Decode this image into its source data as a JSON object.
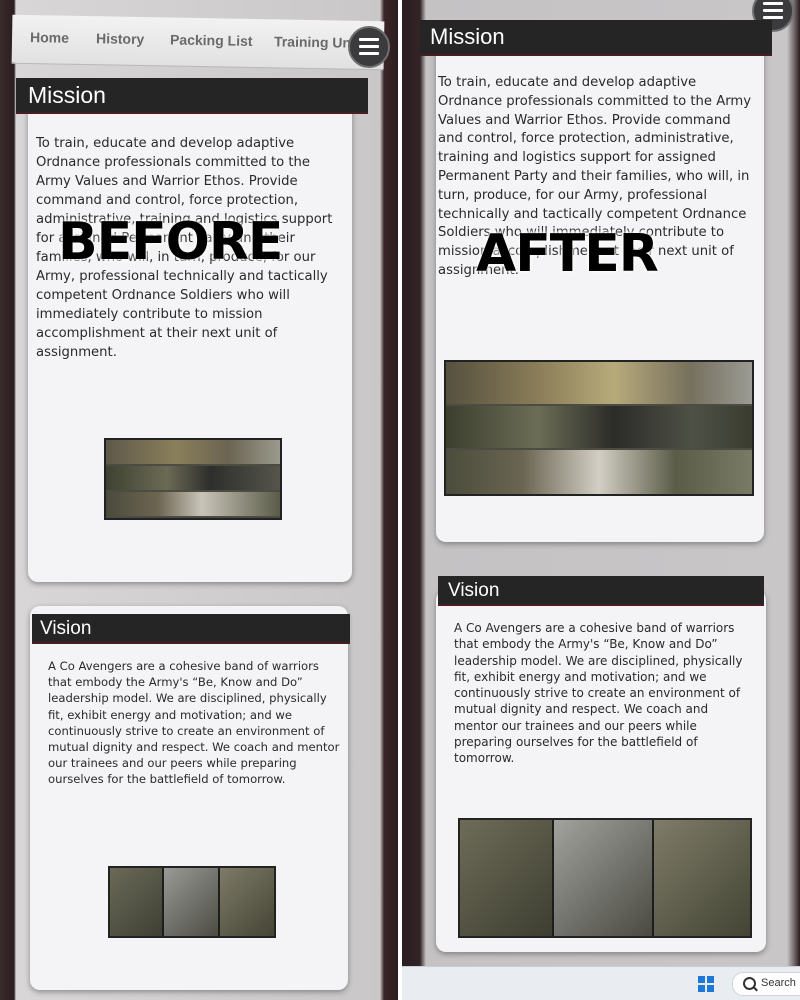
{
  "before": {
    "nav": {
      "items": [
        "Home",
        "History",
        "Packing List",
        "Training Unit"
      ]
    },
    "mission": {
      "title": "Mission",
      "text": "To train, educate and develop adaptive Ordnance professionals committed to the Army Values and Warrior Ethos. Provide command and control, force protection, administrative, training and logistics support for assigned Permanent Party and their families, who will, in turn, produce, for our Army, professional technically and tactically competent Ordnance Soldiers who will immediately contribute to mission accomplishment at their next unit of assignment."
    },
    "vision": {
      "title": "Vision",
      "text": "A Co Avengers are a cohesive band of warriors that embody the Army's “Be, Know and Do” leadership model. We are disciplined, physically fit, exhibit energy and motivation; and we continuously strive to create an environment of mutual dignity and respect. We coach and mentor our trainees and our peers while preparing ourselves for the battlefield of tomorrow."
    },
    "overlay_label": "BEFORE"
  },
  "after": {
    "mission": {
      "title": "Mission",
      "text": "To train, educate and develop adaptive Ordnance professionals committed to the Army Values and Warrior Ethos. Provide command and control, force protection, administrative, training and logistics support for assigned Permanent Party and their families, who will, in turn, produce, for our Army, professional technically and tactically competent Ordnance Soldiers who will immediately contribute to mission accomplishment at their next unit of assignment."
    },
    "vision": {
      "title": "Vision",
      "text": "A Co Avengers are a cohesive band of warriors that embody the Army's “Be, Know and Do” leadership model. We are disciplined, physically fit, exhibit energy and motivation; and we continuously strive to create an environment of mutual dignity and respect. We coach and mentor our trainees and our peers while preparing ourselves for the battlefield of tomorrow."
    },
    "overlay_label": "AFTER",
    "taskbar": {
      "search_label": "Search"
    }
  },
  "colors": {
    "header_bar": "#262525",
    "card_background": "#f4f4f6",
    "frame": "#2a1b1d",
    "windows_blue": "#1e78d7"
  },
  "icons": [
    "hamburger-menu-icon",
    "windows-start-icon",
    "search-icon"
  ]
}
